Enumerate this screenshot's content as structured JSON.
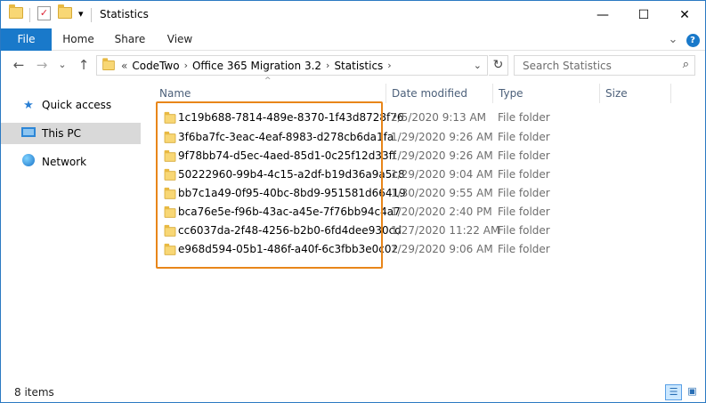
{
  "window": {
    "title": "Statistics",
    "minimize_glyph": "—",
    "maximize_glyph": "☐",
    "close_glyph": "✕",
    "quickaccess_dropdown_glyph": "▾"
  },
  "ribbon": {
    "tabs": [
      {
        "label": "File"
      },
      {
        "label": "Home"
      },
      {
        "label": "Share"
      },
      {
        "label": "View"
      }
    ],
    "expand_glyph": "⌄",
    "help_glyph": "?"
  },
  "nav": {
    "back_glyph": "←",
    "forward_glyph": "→",
    "recent_glyph": "⌄",
    "up_glyph": "↑",
    "breadcrumb": {
      "overflow": "«",
      "items": [
        "CodeTwo",
        "Office 365 Migration 3.2",
        "Statistics"
      ],
      "separator": "›"
    },
    "address_dropdown_glyph": "⌄",
    "refresh_glyph": "↻",
    "search": {
      "placeholder": "Search Statistics",
      "icon": "search-icon",
      "glyph": "⌕"
    }
  },
  "navpane": {
    "items": [
      {
        "label": "Quick access",
        "icon": "star-icon",
        "selected": false
      },
      {
        "label": "This PC",
        "icon": "computer-icon",
        "selected": true
      },
      {
        "label": "Network",
        "icon": "network-icon",
        "selected": false
      }
    ]
  },
  "columns": {
    "name": "Name",
    "date": "Date modified",
    "type": "Type",
    "size": "Size",
    "sort_glyph": "^"
  },
  "files": [
    {
      "name": "1c19b688-7814-489e-8370-1f43d8728f76",
      "date": "2/5/2020 9:13 AM",
      "type": "File folder"
    },
    {
      "name": "3f6ba7fc-3eac-4eaf-8983-d278cb6da1fa",
      "date": "1/29/2020 9:26 AM",
      "type": "File folder"
    },
    {
      "name": "9f78bb74-d5ec-4aed-85d1-0c25f12d33ff",
      "date": "1/29/2020 9:26 AM",
      "type": "File folder"
    },
    {
      "name": "50222960-99b4-4c15-a2df-b19d36a9a5c8",
      "date": "1/29/2020 9:04 AM",
      "type": "File folder"
    },
    {
      "name": "bb7c1a49-0f95-40bc-8bd9-951581d66419",
      "date": "1/30/2020 9:55 AM",
      "type": "File folder"
    },
    {
      "name": "bca76e5e-f96b-43ac-a45e-7f76bb94c4a7",
      "date": "1/20/2020 2:40 PM",
      "type": "File folder"
    },
    {
      "name": "cc6037da-2f48-4256-b2b0-6fd4dee930cd",
      "date": "1/27/2020 11:22 AM",
      "type": "File folder"
    },
    {
      "name": "e968d594-05b1-486f-a40f-6c3fbb3e0c02",
      "date": "1/29/2020 9:06 AM",
      "type": "File folder"
    }
  ],
  "status": {
    "count_text": "8 items",
    "details_view_glyph": "☰",
    "large_icons_glyph": "▣"
  },
  "colors": {
    "accent": "#1979ca",
    "highlight_border": "#e8861a",
    "selection": "#d9d9d9",
    "folder": "#f8d775"
  }
}
